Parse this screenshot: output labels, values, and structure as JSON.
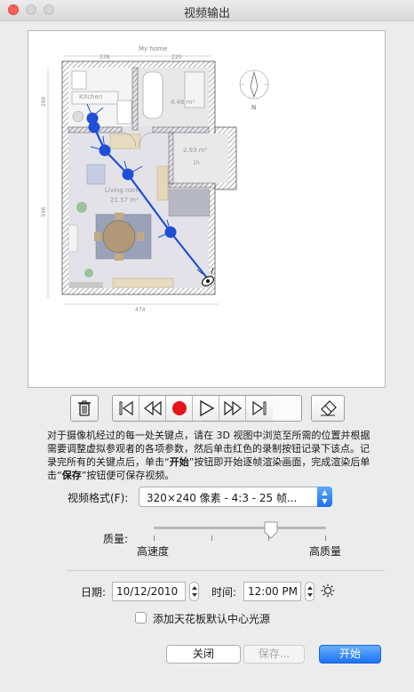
{
  "window": {
    "title": "视频输出"
  },
  "plan": {
    "title": "My home",
    "dim_top_left": "239",
    "dim_top_right": "220",
    "dim_left_top": "290",
    "dim_left_bottom": "596",
    "dim_bottom": "474",
    "kitchen_label": "Kitchen",
    "bath_area": "4.46 m²",
    "small_room_area": "2.93 m²",
    "small_room_label": "1h",
    "living_label": "Living room",
    "living_area": "21.57 m²",
    "compass_label": "N"
  },
  "toolbar": {
    "delete_icon": "trash-icon",
    "first_icon": "skip-to-start-icon",
    "rewind_icon": "rewind-icon",
    "record_icon": "record-icon",
    "play_icon": "play-icon",
    "fastforward_icon": "fast-forward-icon",
    "last_icon": "skip-to-end-icon",
    "clear_icon": "eraser-icon",
    "record_color": "#e8141c"
  },
  "description": {
    "part1": "对于摄像机经过的每一处关键点，请在 3D 视图中浏览至所需的位置并根据需要调整虚拟参观者的各项参数，然后单击红色的录制按钮记录下该点。记录完所有的关键点后，单击“",
    "start_word": "开始",
    "part2": "”按钮即开始逐帧渲染画面，完成渲染后单击“",
    "save_word": "保存",
    "part3": "”按钮便可保存视频。"
  },
  "format": {
    "label": "视频格式(F):",
    "value": "320×240 像素 - 4:3 - 25 帧..."
  },
  "quality": {
    "label": "质量:",
    "low_label": "高速度",
    "high_label": "高质量",
    "level": 0.68
  },
  "date": {
    "label": "日期:",
    "value": "10/12/2010"
  },
  "time": {
    "label": "时间:",
    "value": "12:00 PM"
  },
  "sun_icon": "sun-icon",
  "ceiling_light": {
    "label": "添加天花板默认中心光源",
    "checked": false
  },
  "buttons": {
    "close": "关闭",
    "save": "保存...",
    "start": "开始"
  },
  "colors": {
    "accent": "#1a72f5",
    "path": "#1f4fd6"
  }
}
